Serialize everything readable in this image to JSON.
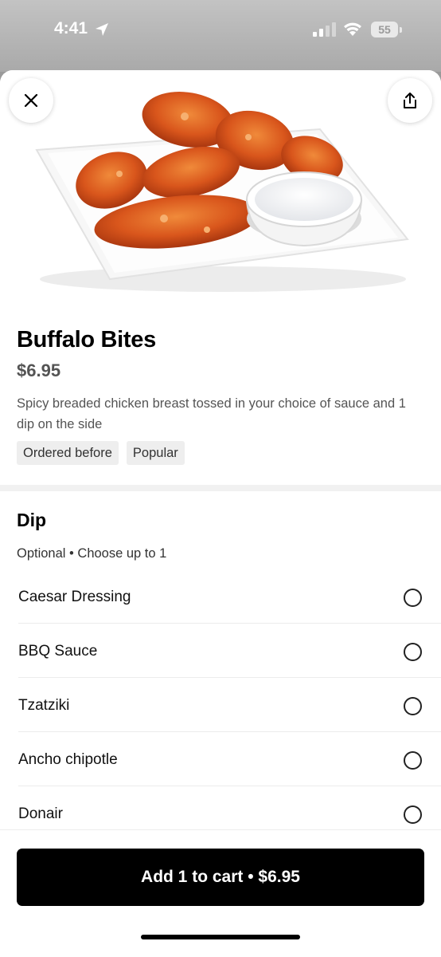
{
  "status_bar": {
    "time": "4:41",
    "battery": "55"
  },
  "item": {
    "title": "Buffalo Bites",
    "price": "$6.95",
    "description": "Spicy breaded chicken breast tossed in your choice of sauce and 1 dip on the side",
    "tags": [
      "Ordered before",
      "Popular"
    ]
  },
  "dip_section": {
    "title": "Dip",
    "subtitle": "Optional • Choose up to 1",
    "options": [
      {
        "label": "Caesar Dressing"
      },
      {
        "label": "BBQ Sauce"
      },
      {
        "label": "Tzatziki"
      },
      {
        "label": "Ancho chipotle"
      },
      {
        "label": "Donair"
      }
    ]
  },
  "cart_button": {
    "label": "Add 1 to cart  • $6.95"
  },
  "icons": {
    "close": "close-icon",
    "share": "share-icon",
    "location": "location-arrow-icon",
    "signal": "cellular-signal-icon",
    "wifi": "wifi-icon",
    "battery": "battery-icon"
  },
  "colors": {
    "primary_button": "#000000",
    "tag_background": "#eeeeee",
    "secondary_text": "#545454"
  }
}
